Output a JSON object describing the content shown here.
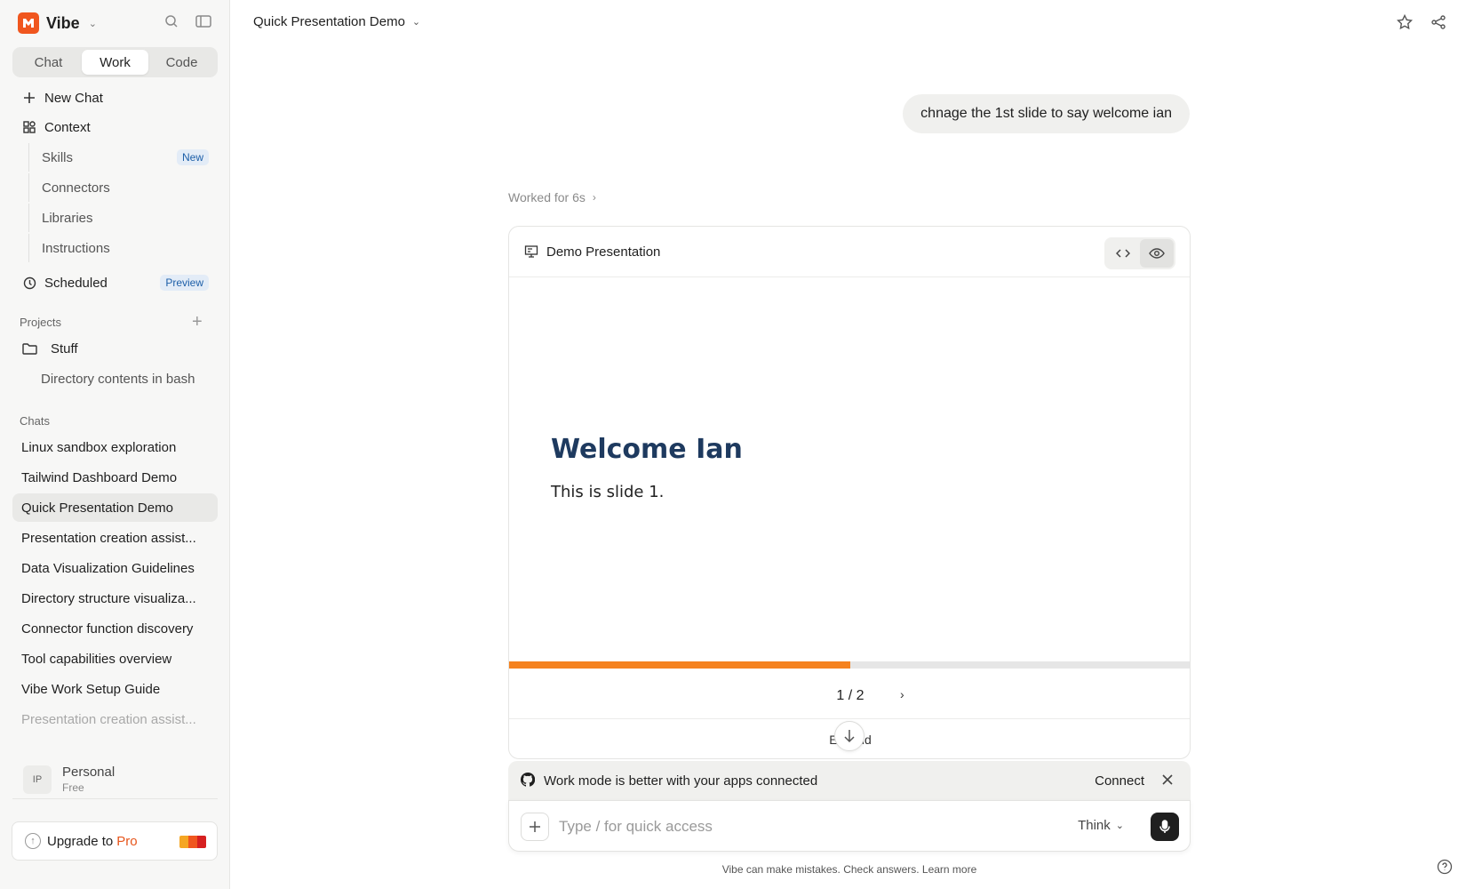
{
  "sidebar": {
    "brand": "Vibe",
    "modes": [
      "Chat",
      "Work",
      "Code"
    ],
    "active_mode": "Work",
    "new_chat": "New Chat",
    "context": "Context",
    "context_items": [
      {
        "label": "Skills",
        "badge": "New"
      },
      {
        "label": "Connectors"
      },
      {
        "label": "Libraries"
      },
      {
        "label": "Instructions"
      }
    ],
    "scheduled": "Scheduled",
    "scheduled_badge": "Preview",
    "projects_label": "Projects",
    "project_name": "Stuff",
    "project_item": "Directory contents in bash",
    "chats_label": "Chats",
    "chats": [
      "Linux sandbox exploration",
      "Tailwind Dashboard Demo",
      "Quick Presentation Demo",
      "Presentation creation assist...",
      "Data Visualization Guidelines",
      "Directory structure visualiza...",
      "Connector function discovery",
      "Tool capabilities overview",
      "Vibe Work Setup Guide",
      "Presentation creation assist..."
    ],
    "active_chat_index": 2,
    "account": {
      "initials": "IP",
      "name": "Personal",
      "plan": "Free"
    },
    "upgrade": {
      "text": "Upgrade to",
      "highlight": "Pro"
    }
  },
  "header": {
    "title": "Quick Presentation Demo"
  },
  "conversation": {
    "user_message": "chnage the 1st slide to say welcome ian",
    "worked_for": "Worked for 6s"
  },
  "artifact": {
    "title": "Demo Presentation",
    "slide_title": "Welcome Ian",
    "slide_body": "This is slide 1.",
    "progress_fraction": 0.5,
    "pager": "1 / 2",
    "expand_label": "Expand"
  },
  "banner": {
    "text": "Work mode is better with your apps connected",
    "connect": "Connect"
  },
  "composer": {
    "placeholder": "Type / for quick access",
    "think": "Think"
  },
  "footer": "Vibe can make mistakes. Check answers. Learn more",
  "colors": {
    "accent": "#f0561e",
    "progress": "#f5821f",
    "slide_title": "#1e3a5f"
  }
}
